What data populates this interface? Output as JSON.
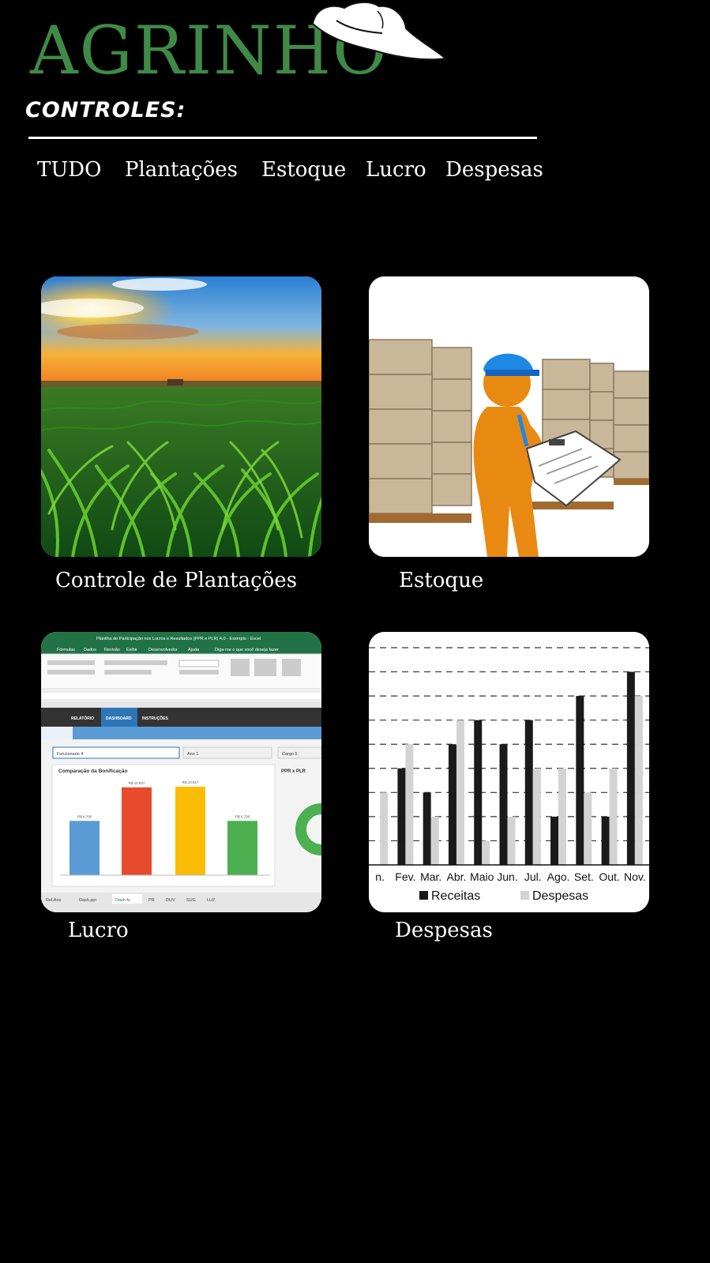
{
  "header": {
    "logo_text": "AGRINHO",
    "section_title": "CONTROLES:"
  },
  "nav": {
    "items": [
      "TUDO",
      "Plantações",
      "Estoque",
      "Lucro",
      "Despesas"
    ]
  },
  "cards": [
    {
      "caption": "Controle de Plantações",
      "image": "corn-field-sunset"
    },
    {
      "caption": "Estoque",
      "image": "warehouse-worker-clipboard"
    },
    {
      "caption": "Lucro",
      "image": "spreadsheet-bonus-chart"
    },
    {
      "caption": "Despesas",
      "image": "revenue-expense-bar-chart"
    }
  ],
  "spreadsheet": {
    "titlebar": "Planilha de Participação nos Lucros e Resultados (PPR e PLR) 4.0 - Exemplo - Excel",
    "ribbon_tabs": [
      "Fórmulas",
      "Dados",
      "Revisão",
      "Exibir",
      "Desenvolvedor",
      "Ajuda"
    ],
    "tell_me": "Diga-me o que você deseja fazer",
    "sheet_tabs": [
      "RELATÓRIO",
      "DASHBOARD",
      "INSTRUÇÕES"
    ],
    "filters": [
      "Funcionario 4",
      "Ano 1",
      "Cargo 5"
    ],
    "chart_title": "Comparação da Bonificação",
    "side_title": "PPR x PLR",
    "bar_labels": [
      "R$ 6.700",
      "R$ 10.837",
      "R$ 10.917",
      "R$ 6.700"
    ],
    "bar_values": [
      6.7,
      10.837,
      10.917,
      6.7
    ],
    "bar_colors": [
      "#5b9bd5",
      "#e84b2c",
      "#fbbc05",
      "#4caf50"
    ],
    "bottom_tabs": [
      "Rel.Ano",
      "Dash.ppr",
      "Dash fu",
      "PR",
      "DUV",
      "SUG",
      "LUZ"
    ]
  },
  "chart_data": {
    "type": "bar",
    "categories": [
      "n.",
      "Fev.",
      "Mar.",
      "Abr.",
      "Maio",
      "Jun.",
      "Jul.",
      "Ago.",
      "Set.",
      "Out.",
      "Nov."
    ],
    "series": [
      {
        "name": "Receitas",
        "values": [
          null,
          4,
          3,
          5,
          6,
          5,
          6,
          2,
          7,
          2,
          8
        ],
        "color": "#1a1a1a"
      },
      {
        "name": "Despesas",
        "values": [
          3,
          5,
          2,
          6,
          1,
          2,
          4,
          4,
          3,
          4,
          7
        ],
        "color": "#d3d3d3"
      }
    ],
    "ylim": [
      0,
      9
    ],
    "grid": true,
    "legend": "bottom"
  }
}
